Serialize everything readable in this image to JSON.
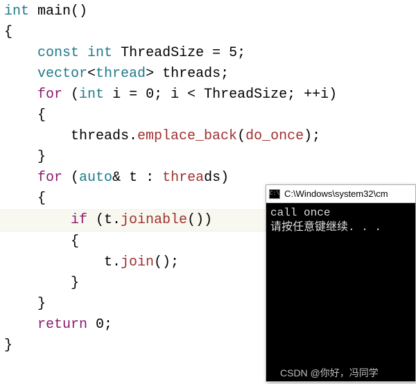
{
  "code": {
    "l1_type": "int",
    "l1_name": " main",
    "l1_paren": "()",
    "l2": "{",
    "l3_indent": "    ",
    "l3_kw1": "const",
    "l3_sp1": " ",
    "l3_kw2": "int",
    "l3_rest": " ThreadSize = 5;",
    "l4_indent": "    ",
    "l4_vec": "vector",
    "l4_lt": "<",
    "l4_thread": "thread",
    "l4_gt": ">",
    "l4_rest": " threads;",
    "l5_indent": "    ",
    "l5_for": "for",
    "l5_sp": " (",
    "l5_int": "int",
    "l5_rest": " i = 0; i < ThreadSize; ++i)",
    "l6": "    {",
    "l7_indent": "        threads.",
    "l7_func": "emplace_back",
    "l7_paren1": "(",
    "l7_arg": "do_once",
    "l7_paren2": ");",
    "l8": "    }",
    "l9_indent": "    ",
    "l9_for": "for",
    "l9_sp": " (",
    "l9_auto": "auto",
    "l9_amp": "& t : ",
    "l9_threads": "threa",
    "l9_rest": "ds)",
    "l10": "    {",
    "l11_indent": "        ",
    "l11_if": "if",
    "l11_sp": " (t.",
    "l11_func": "joinable",
    "l11_rest": "())",
    "l12": "        {",
    "l13_indent": "            t.",
    "l13_func": "join",
    "l13_rest": "();",
    "l14": "        }",
    "l15": "    }",
    "l16_indent": "    ",
    "l16_ret": "return",
    "l16_rest": " 0;",
    "l17": "}"
  },
  "terminal": {
    "title": "C:\\Windows\\system32\\cm",
    "line1": "call once",
    "line2": "请按任意键继续. . ."
  },
  "watermark": "CSDN @你好，冯同学"
}
